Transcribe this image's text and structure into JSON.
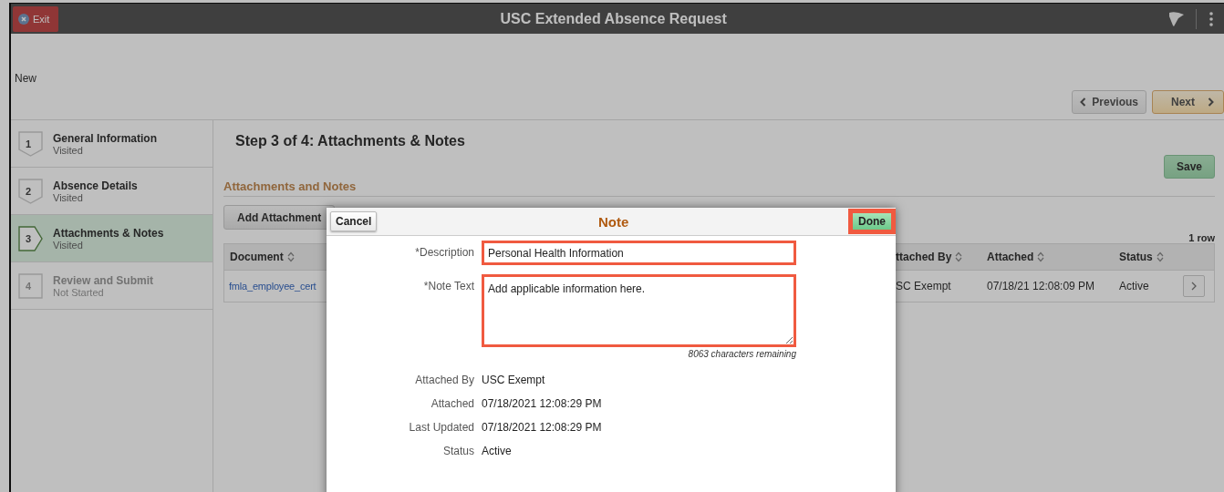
{
  "header": {
    "exit_label": "Exit",
    "title": "USC Extended Absence Request"
  },
  "status_label": "New",
  "nav": {
    "previous": "Previous",
    "next": "Next"
  },
  "steps": [
    {
      "number": "1",
      "label": "General Information",
      "status": "Visited",
      "selected": false,
      "disabled": false
    },
    {
      "number": "2",
      "label": "Absence Details",
      "status": "Visited",
      "selected": false,
      "disabled": false
    },
    {
      "number": "3",
      "label": "Attachments & Notes",
      "status": "Visited",
      "selected": true,
      "disabled": false
    },
    {
      "number": "4",
      "label": "Review and Submit",
      "status": "Not Started",
      "selected": false,
      "disabled": true
    }
  ],
  "content": {
    "title": "Step 3 of 4: Attachments & Notes",
    "save": "Save",
    "section_title": "Attachments and Notes",
    "add_button": "Add Attachment",
    "row_count": "1 row",
    "table": {
      "columns": [
        "Document",
        "ttached By",
        "Attached",
        "Status"
      ],
      "rows": [
        {
          "cells": [
            "fmla_employee_cert",
            "SC Exempt",
            "07/18/21 12:08:09 PM",
            "Active"
          ]
        }
      ]
    }
  },
  "dialog": {
    "title": "Note",
    "cancel": "Cancel",
    "done": "Done",
    "done_highlighted": true,
    "fields": [
      {
        "kind": "input",
        "label": "*Description",
        "value": "Personal Health Information",
        "highlighted": true
      },
      {
        "kind": "textarea",
        "label": "*Note Text",
        "value": "Add applicable information here.",
        "highlighted": true
      }
    ],
    "remaining": "8063 characters remaining",
    "details": [
      {
        "label": "Attached By",
        "value": "USC Exempt"
      },
      {
        "label": "Attached",
        "value": "07/18/2021 12:08:29 PM"
      },
      {
        "label": "Last Updated",
        "value": "07/18/2021 12:08:29 PM"
      },
      {
        "label": "Status",
        "value": "Active"
      }
    ]
  }
}
